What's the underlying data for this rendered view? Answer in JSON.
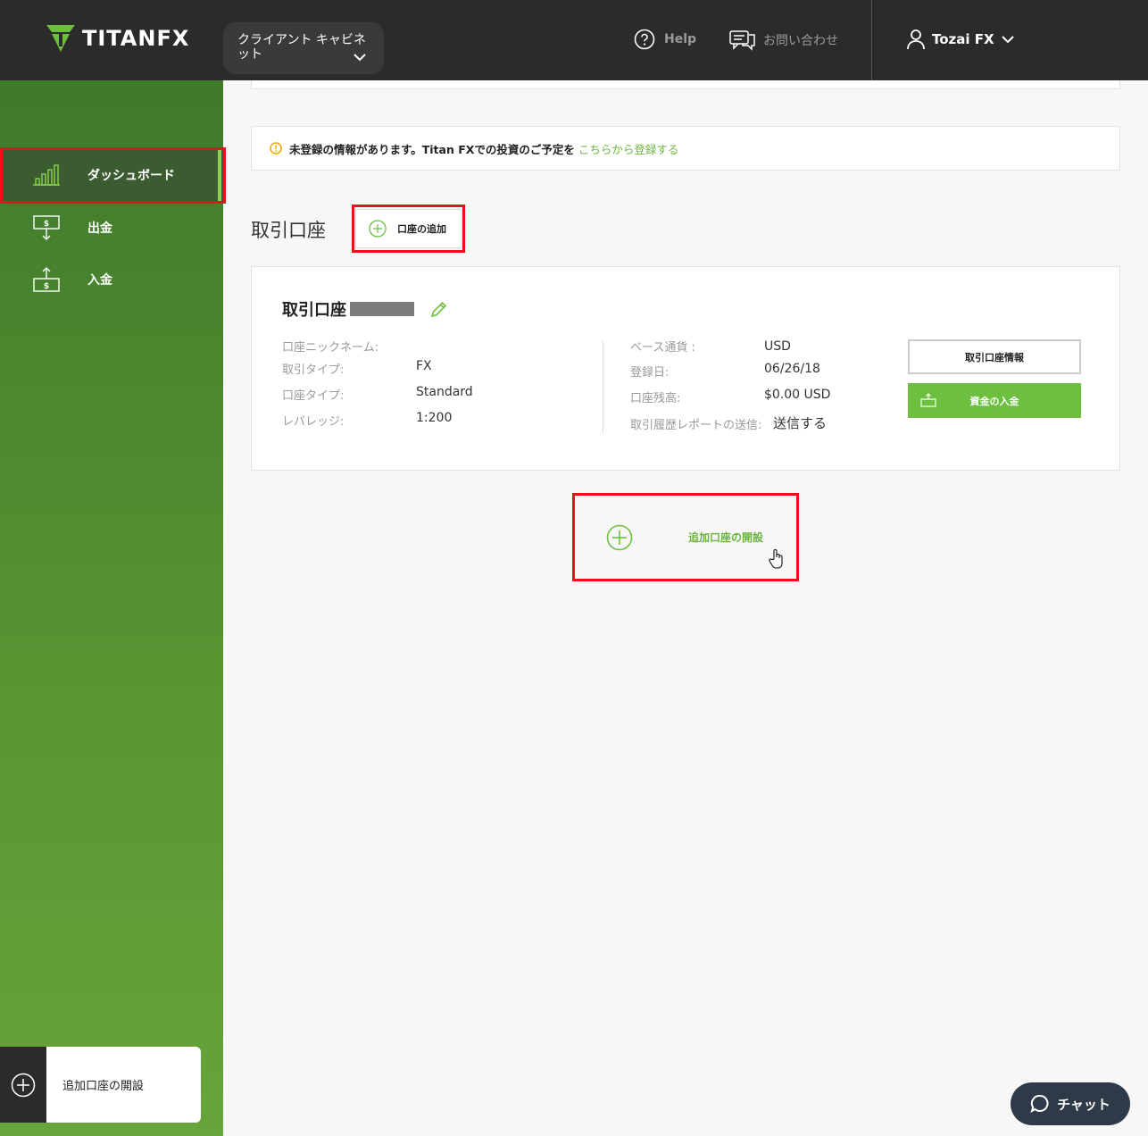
{
  "header": {
    "logo_text": "TITANFX",
    "cabinet_label": "クライアント キャビネット",
    "help_label": "Help",
    "contact_label": "お問い合わせ",
    "user_name": "Tozai FX"
  },
  "sidebar": {
    "items": [
      {
        "label": "ダッシュボード",
        "icon": "bar-chart-icon",
        "active": true
      },
      {
        "label": "出金",
        "icon": "withdraw-icon"
      },
      {
        "label": "入金",
        "icon": "deposit-icon"
      }
    ],
    "cta_label": "追加口座の開設"
  },
  "notice": {
    "text": "未登録の情報があります。Titan FXでの投資のご予定を",
    "link": "こちらから登録する"
  },
  "section": {
    "title": "取引口座",
    "add_button": "口座の追加"
  },
  "account_card": {
    "title": "取引口座",
    "fields_left": [
      {
        "label": "口座ニックネーム:",
        "value": ""
      },
      {
        "label": "取引タイプ:",
        "value": "FX"
      },
      {
        "label": "口座タイプ:",
        "value": "Standard"
      },
      {
        "label": "レバレッジ:",
        "value": "1:200"
      }
    ],
    "fields_right": [
      {
        "label": "ベース通貨 :",
        "value": "USD"
      },
      {
        "label": "登録日:",
        "value": "06/26/18"
      },
      {
        "label": "口座残高:",
        "value": "$0.00 USD"
      },
      {
        "label": "取引履歴レポートの送信:",
        "value": "送信する"
      }
    ],
    "info_button": "取引口座情報",
    "deposit_button": "資金の入金"
  },
  "open_account": {
    "label": "追加口座の開設"
  },
  "chat": {
    "label": "チャット"
  },
  "colors": {
    "brand_green": "#6cbf3f",
    "topbar": "#2b2b2b",
    "highlight_red": "#e8121b"
  }
}
